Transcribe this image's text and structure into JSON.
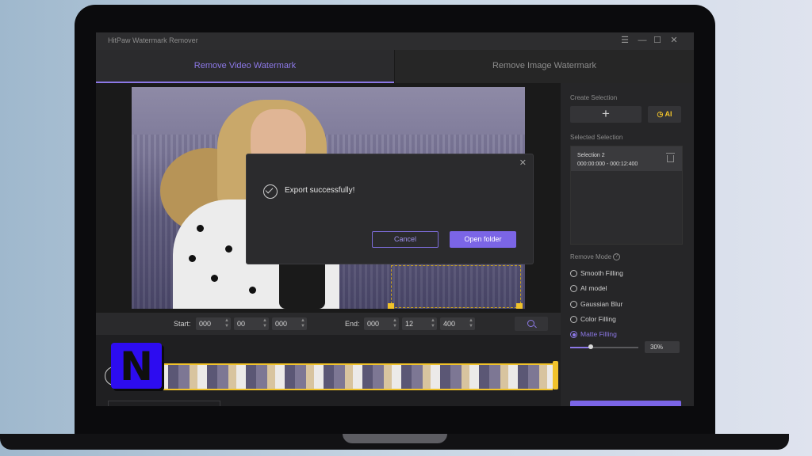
{
  "window": {
    "title": "HitPaw Watermark Remover",
    "controls": [
      "☰",
      "—",
      "☐",
      "✕"
    ]
  },
  "tabs": [
    {
      "label": "Remove Video Watermark",
      "active": true
    },
    {
      "label": "Remove Image Watermark",
      "active": false
    }
  ],
  "dialog": {
    "message": "Export successfully!",
    "cancel_label": "Cancel",
    "open_label": "Open folder",
    "close_glyph": "✕"
  },
  "time": {
    "start_label": "Start:",
    "end_label": "End:",
    "start": [
      "000",
      "00",
      "000"
    ],
    "end": [
      "000",
      "12",
      "400"
    ]
  },
  "panel": {
    "create_selection_label": "Create Selection",
    "add_glyph": "+",
    "ai_label": "AI",
    "selected_selection_label": "Selected Selection",
    "selection": {
      "name": "Selection 2",
      "range": "000:00:000 - 000:12:400"
    },
    "remove_mode_label": "Remove Mode",
    "modes": [
      {
        "label": "Smooth Filling",
        "selected": false
      },
      {
        "label": "AI model",
        "selected": false
      },
      {
        "label": "Gaussian Blur",
        "selected": false
      },
      {
        "label": "Color Filling",
        "selected": false
      },
      {
        "label": "Matte Filling",
        "selected": true
      }
    ],
    "opacity_level": 0.3,
    "opacity_text": "30%"
  },
  "badge": {
    "letter": "N"
  },
  "colors": {
    "accent": "#7b65e6",
    "selection": "#f0c22b",
    "badge": "#2d0cf0"
  }
}
